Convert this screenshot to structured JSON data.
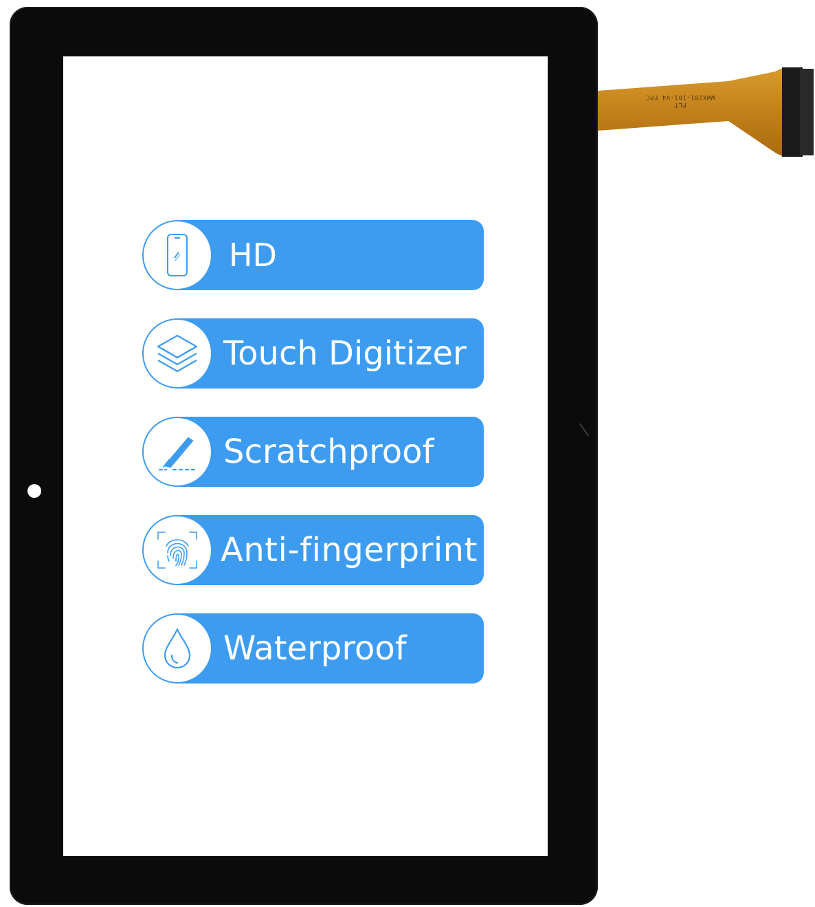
{
  "product": {
    "cable_label_line1": "FLT",
    "cable_label_line2": "WWX281-101-V4 FPC"
  },
  "features": [
    {
      "label": "HD",
      "icon": "phone-screen-icon"
    },
    {
      "label": "Touch Digitizer",
      "icon": "layers-icon"
    },
    {
      "label": "Scratchproof",
      "icon": "blade-scratch-icon"
    },
    {
      "label": "Anti-fingerprint",
      "icon": "fingerprint-icon"
    },
    {
      "label": "Waterproof",
      "icon": "water-drop-icon"
    }
  ],
  "colors": {
    "accent": "#3d9cf0",
    "bezel": "#0b0b0b",
    "cable": "#c88a1e"
  }
}
